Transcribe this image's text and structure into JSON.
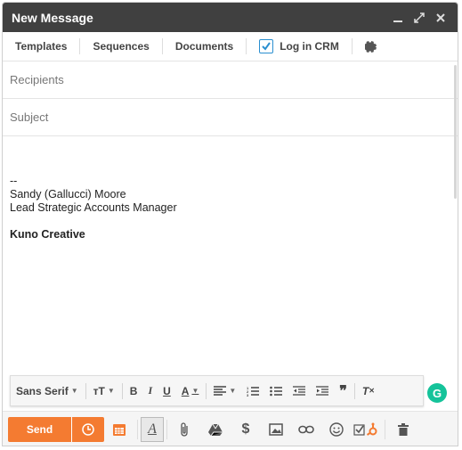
{
  "window": {
    "title": "New Message"
  },
  "toolbar": {
    "templates": "Templates",
    "sequences": "Sequences",
    "documents": "Documents",
    "log_in_crm": "Log in CRM"
  },
  "fields": {
    "recipients_placeholder": "Recipients",
    "subject_placeholder": "Subject"
  },
  "body": {
    "dash": "--",
    "name": "Sandy (Gallucci) Moore",
    "job_title": "Lead Strategic Accounts Manager",
    "company": "Kuno Creative"
  },
  "format": {
    "font": "Sans Serif"
  },
  "grammarly": "G",
  "send_label": "Send",
  "colors": {
    "titlebar": "#404040",
    "accent": "#f47b31",
    "grammarly": "#15c39a",
    "checkbox": "#2a8fd0"
  }
}
